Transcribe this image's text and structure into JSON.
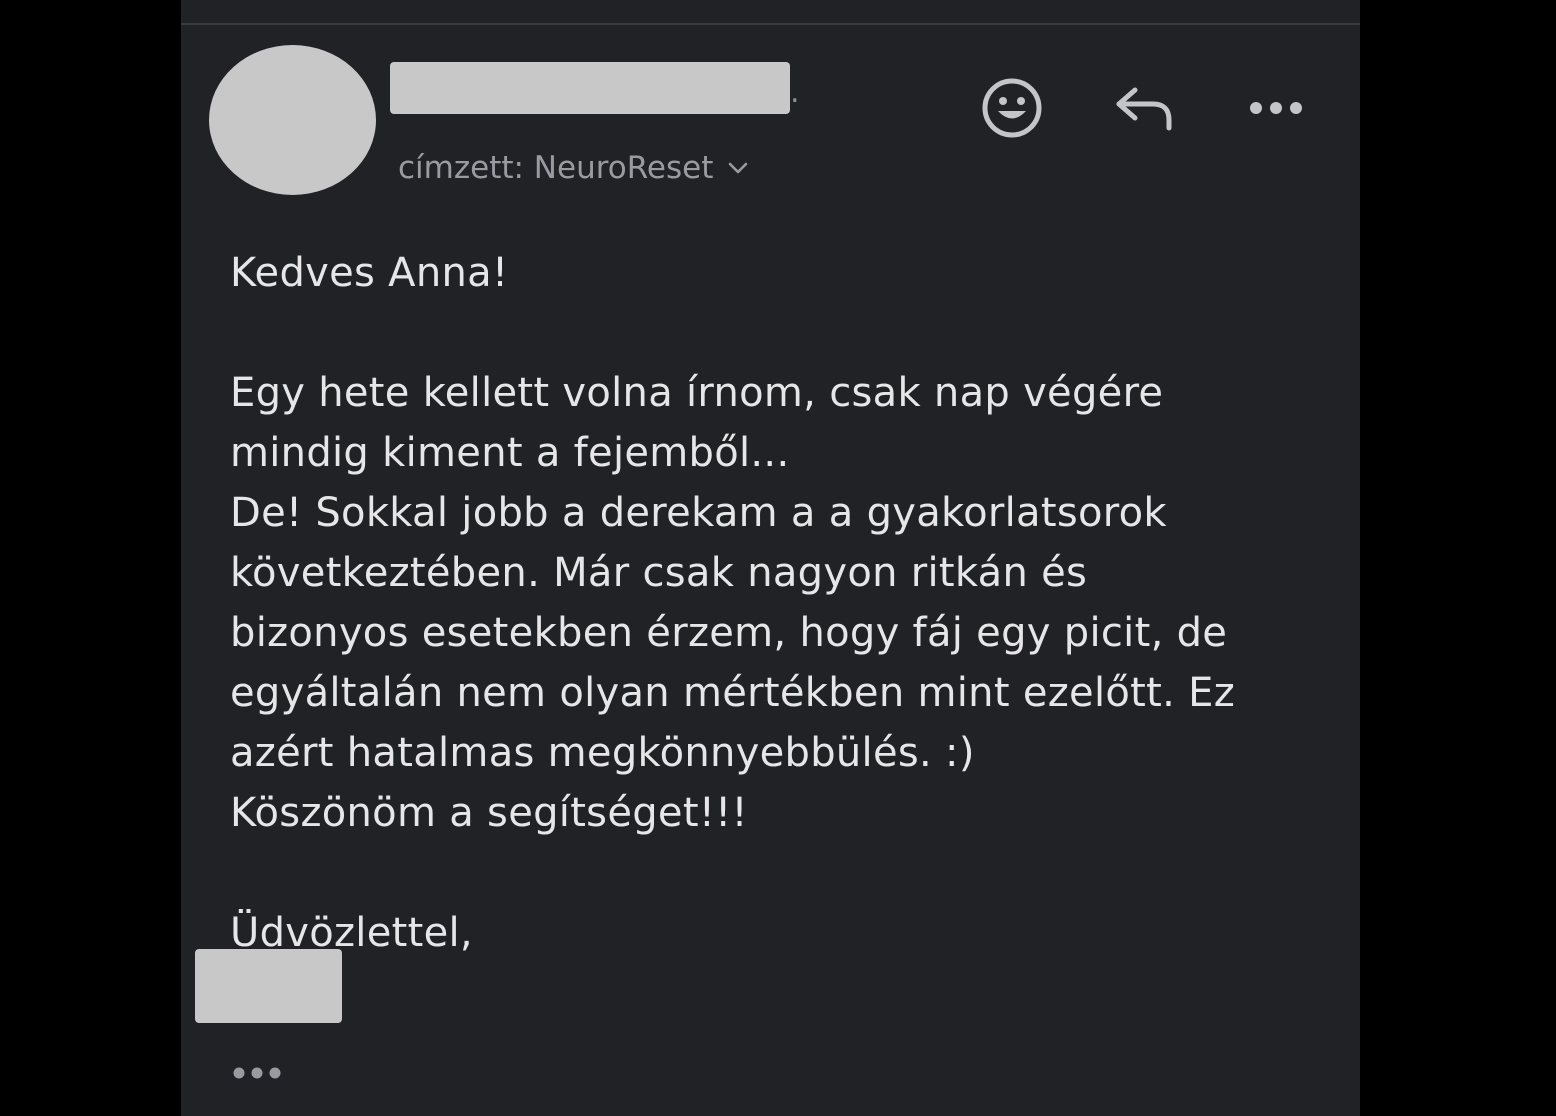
{
  "email": {
    "sender_tail": ".",
    "recipient_label": "címzett: NeuroReset",
    "body": {
      "greeting": "Kedves Anna!",
      "paragraph": [
        "Egy hete kellett volna írnom, csak nap végére",
        "mindig kiment a fejemből...",
        "De! Sokkal jobb a derekam a a gyakorlatsorok",
        "következtében. Már csak nagyon ritkán és",
        "bizonyos esetekben érzem, hogy fáj egy picit, de",
        "egyáltalán nem olyan mértékben mint ezelőtt. Ez",
        "azért hatalmas megkönnyebbülés. :)",
        "Köszönöm a segítséget!!!"
      ],
      "closing": "Üdvözlettel,"
    }
  },
  "actions": {
    "emoji_icon": "smiley-icon",
    "reply_icon": "reply-arrow-icon",
    "more_icon": "more-dots-icon",
    "expand_icon": "expand-quoted-dots-icon"
  },
  "colors": {
    "background": "#212226",
    "text": "#e6e6e8",
    "muted_text": "#9a9ba0",
    "icon": "#c4c5c9",
    "redaction": "#c8c8c8"
  }
}
